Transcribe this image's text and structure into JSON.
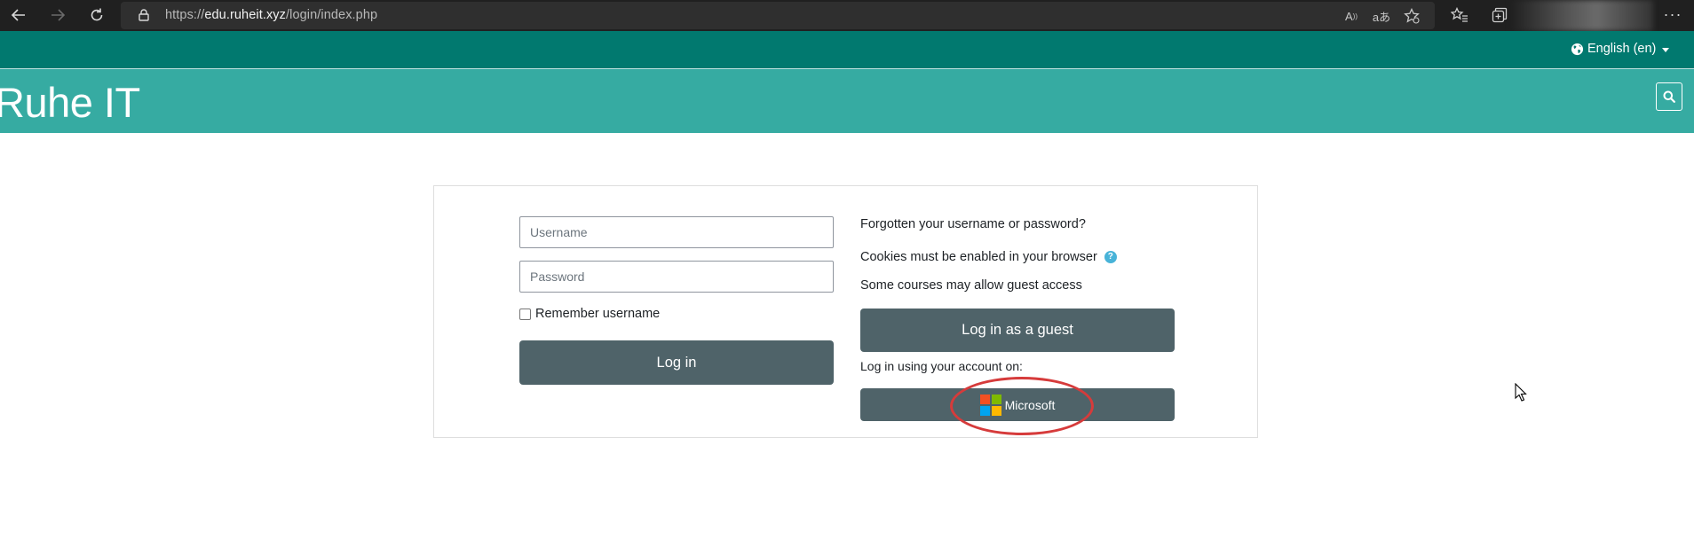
{
  "browser": {
    "url_scheme": "https://",
    "url_host": "edu.ruheit.xyz",
    "url_path": "/login/index.php",
    "more_label": "···"
  },
  "topbar": {
    "language": "English (en)"
  },
  "header": {
    "site_title": "Ruhe IT"
  },
  "login": {
    "username_placeholder": "Username",
    "password_placeholder": "Password",
    "remember_label": "Remember username",
    "login_button": "Log in",
    "forgotten_link": "Forgotten your username or password?",
    "cookies_text": "Cookies must be enabled in your browser",
    "guest_text": "Some courses may allow guest access",
    "guest_button": "Log in as a guest",
    "account_text": "Log in using your account on:",
    "microsoft_button": "Microsoft",
    "help_glyph": "?"
  },
  "colors": {
    "topbar": "#01796f",
    "header": "#36aba2",
    "button": "#4f6369",
    "annotation_circle": "#d63b3b"
  }
}
